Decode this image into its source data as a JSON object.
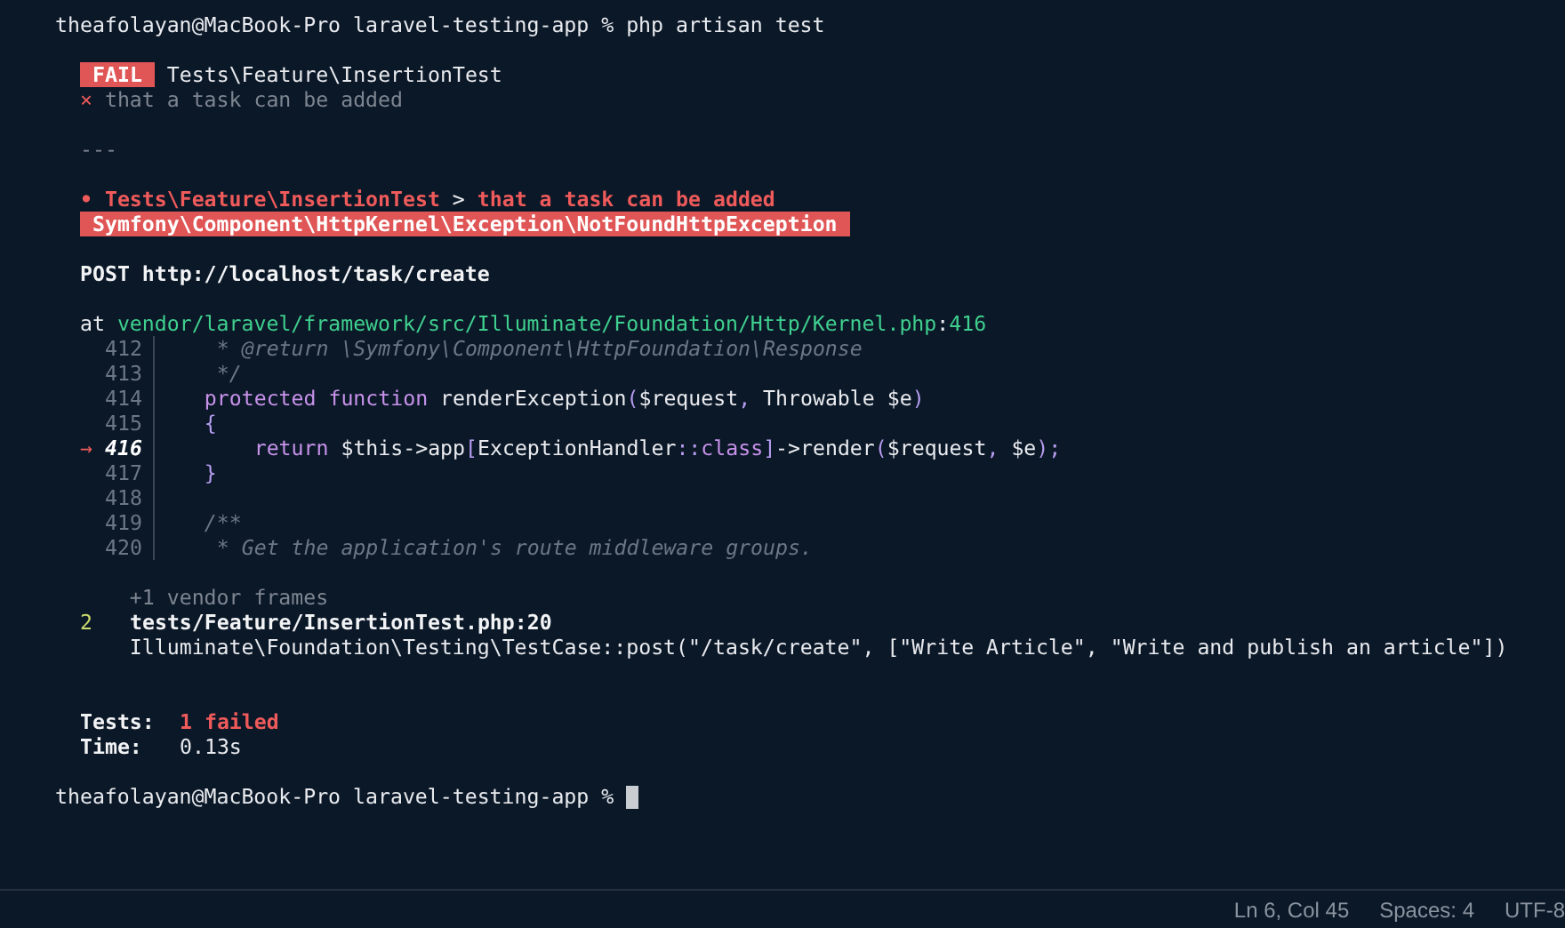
{
  "terminal": {
    "lines": [
      {
        "kind": "prompt",
        "cursor": false,
        "items": [
          {
            "kind": "prompt",
            "text": "theafolayan@MacBook-Pro laravel-testing-app % php artisan test"
          }
        ]
      },
      {
        "kind": "blank"
      },
      {
        "kind": "output",
        "items": [
          {
            "kind": "badge",
            "text": "FAIL"
          },
          {
            "kind": "heading",
            "text": "Tests\\Feature\\InsertionTest"
          }
        ]
      },
      {
        "kind": "output",
        "items": [
          {
            "kind": "failure",
            "segments": [
              {
                "kind": "red",
                "text": "×"
              },
              {
                "kind": "dim",
                "text": " that a task can be added"
              }
            ]
          }
        ]
      },
      {
        "kind": "blank"
      },
      {
        "kind": "output",
        "items": [
          {
            "kind": "separator",
            "text": "---"
          }
        ]
      },
      {
        "kind": "blank"
      },
      {
        "kind": "output",
        "items": [
          {
            "kind": "error-title",
            "segments": [
              {
                "kind": "red-bold",
                "text": "• Tests\\Feature\\InsertionTest"
              },
              {
                "kind": "plain",
                "text": " > "
              },
              {
                "kind": "red-bold",
                "text": "that a task can be added"
              }
            ]
          }
        ]
      },
      {
        "kind": "output",
        "items": [
          {
            "kind": "exception",
            "text": " Symfony\\Component\\HttpKernel\\Exception\\NotFoundHttpException "
          }
        ]
      },
      {
        "kind": "blank"
      },
      {
        "kind": "output",
        "items": [
          {
            "kind": "request",
            "text": "POST http://localhost/task/create"
          }
        ]
      },
      {
        "kind": "blank"
      },
      {
        "kind": "output",
        "items": [
          {
            "kind": "location",
            "segments": [
              {
                "kind": "plain",
                "text": "at "
              },
              {
                "kind": "green",
                "text": "vendor/laravel/framework/src/Illuminate/Foundation/Http/Kernel.php"
              },
              {
                "kind": "plain",
                "text": ":"
              },
              {
                "kind": "green",
                "text": "416"
              }
            ]
          }
        ]
      },
      {
        "kind": "code",
        "number": "412",
        "current": false,
        "segments": [
          {
            "kind": "comment",
            "text": "     * @return \\Symfony\\Component\\HttpFoundation\\Response"
          }
        ]
      },
      {
        "kind": "code",
        "number": "413",
        "current": false,
        "segments": [
          {
            "kind": "comment",
            "text": "     */"
          }
        ]
      },
      {
        "kind": "code",
        "number": "414",
        "current": false,
        "segments": [
          {
            "kind": "keyword",
            "text": "    protected function"
          },
          {
            "kind": "plain",
            "text": " renderException"
          },
          {
            "kind": "punct",
            "text": "("
          },
          {
            "kind": "plain",
            "text": "$request"
          },
          {
            "kind": "punct",
            "text": ", "
          },
          {
            "kind": "plain",
            "text": "Throwable $e"
          },
          {
            "kind": "punct",
            "text": ")"
          }
        ]
      },
      {
        "kind": "code",
        "number": "415",
        "current": false,
        "segments": [
          {
            "kind": "punct",
            "text": "    {"
          }
        ]
      },
      {
        "kind": "code",
        "number": "416",
        "current": true,
        "arrow": "→",
        "segments": [
          {
            "kind": "keyword",
            "text": "        return"
          },
          {
            "kind": "plain",
            "text": " $this->app"
          },
          {
            "kind": "punct",
            "text": "["
          },
          {
            "kind": "plain",
            "text": "ExceptionHandler"
          },
          {
            "kind": "punct",
            "text": "::"
          },
          {
            "kind": "keyword",
            "text": "class"
          },
          {
            "kind": "punct",
            "text": "]"
          },
          {
            "kind": "plain",
            "text": "->render"
          },
          {
            "kind": "punct",
            "text": "("
          },
          {
            "kind": "plain",
            "text": "$request"
          },
          {
            "kind": "punct",
            "text": ", "
          },
          {
            "kind": "plain",
            "text": "$e"
          },
          {
            "kind": "punct",
            "text": ");"
          }
        ]
      },
      {
        "kind": "code",
        "number": "417",
        "current": false,
        "segments": [
          {
            "kind": "punct",
            "text": "    }"
          }
        ]
      },
      {
        "kind": "code",
        "number": "418",
        "current": false
      },
      {
        "kind": "code",
        "number": "419",
        "current": false,
        "segments": [
          {
            "kind": "comment",
            "text": "    /**"
          }
        ]
      },
      {
        "kind": "code",
        "number": "420",
        "current": false,
        "segments": [
          {
            "kind": "comment",
            "text": "     * Get the application's route middleware groups."
          }
        ]
      },
      {
        "kind": "blank"
      },
      {
        "kind": "output",
        "items": [
          {
            "kind": "vendor-note",
            "text": "    +1 vendor frames"
          }
        ]
      },
      {
        "kind": "output",
        "items": [
          {
            "kind": "frame-number",
            "text": "2"
          },
          {
            "kind": "frame-file",
            "text": "tests/Feature/InsertionTest.php:20"
          }
        ]
      },
      {
        "kind": "output",
        "items": [
          {
            "kind": "frame-call",
            "text": "    Illuminate\\Foundation\\Testing\\TestCase::post(\"/task/create\", [\"Write Article\", \"Write and publish an article\"])"
          }
        ]
      },
      {
        "kind": "blank"
      },
      {
        "kind": "blank"
      },
      {
        "kind": "output",
        "items": [
          {
            "kind": "summary-label",
            "text": "Tests:"
          },
          {
            "kind": "summary-failed",
            "text": "1 failed"
          }
        ]
      },
      {
        "kind": "output",
        "items": [
          {
            "kind": "summary-label",
            "text": "Time:"
          },
          {
            "kind": "summary-value",
            "text": "0.13s"
          }
        ]
      },
      {
        "kind": "blank"
      },
      {
        "kind": "prompt",
        "cursor": true,
        "items": [
          {
            "kind": "prompt",
            "text": "theafolayan@MacBook-Pro laravel-testing-app %"
          }
        ]
      }
    ]
  },
  "status_bar": {
    "items": [
      "Ln 6, Col 45",
      "Spaces: 4",
      "UTF-8"
    ]
  }
}
